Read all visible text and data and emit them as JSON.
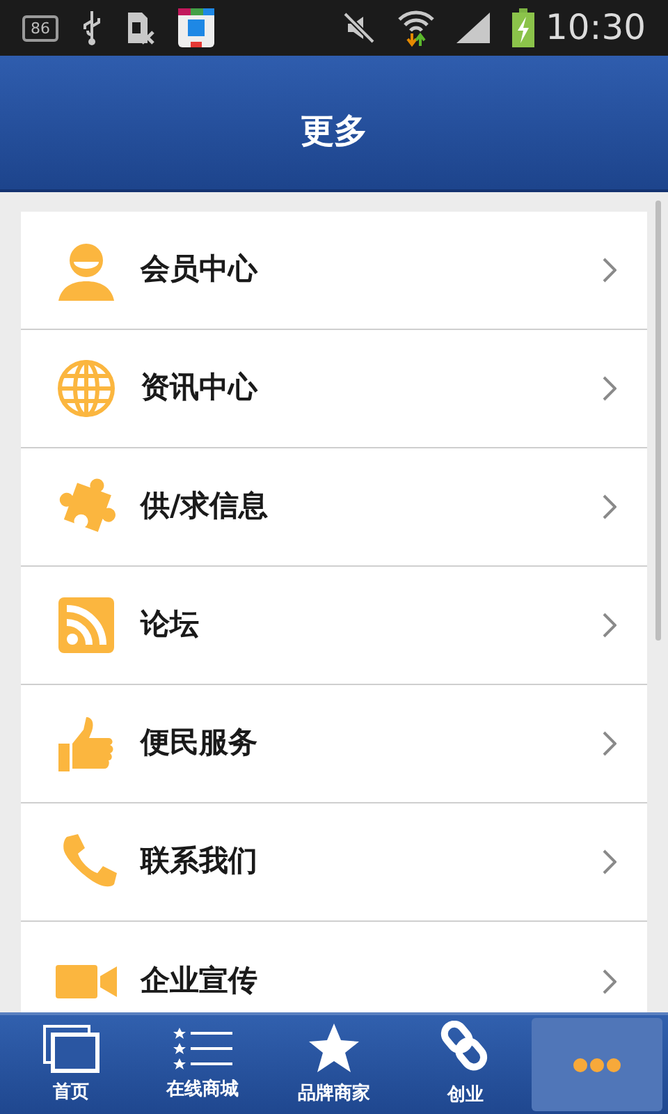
{
  "status_bar": {
    "badge": "86",
    "time": "10:30"
  },
  "header": {
    "title": "更多"
  },
  "menu": [
    {
      "kind": "member",
      "label": "会员中心"
    },
    {
      "kind": "news",
      "label": "资讯中心"
    },
    {
      "kind": "supply",
      "label": "供/求信息"
    },
    {
      "kind": "forum",
      "label": "论坛"
    },
    {
      "kind": "service",
      "label": "便民服务"
    },
    {
      "kind": "contact",
      "label": "联系我们"
    },
    {
      "kind": "promo",
      "label": "企业宣传"
    }
  ],
  "tab_bar": [
    {
      "kind": "home",
      "label": "首页",
      "selected": false
    },
    {
      "kind": "mall",
      "label": "在线商城",
      "selected": false
    },
    {
      "kind": "brand",
      "label": "品牌商家",
      "selected": false
    },
    {
      "kind": "link",
      "label": "创业",
      "selected": false
    },
    {
      "kind": "more",
      "selected": true
    }
  ]
}
